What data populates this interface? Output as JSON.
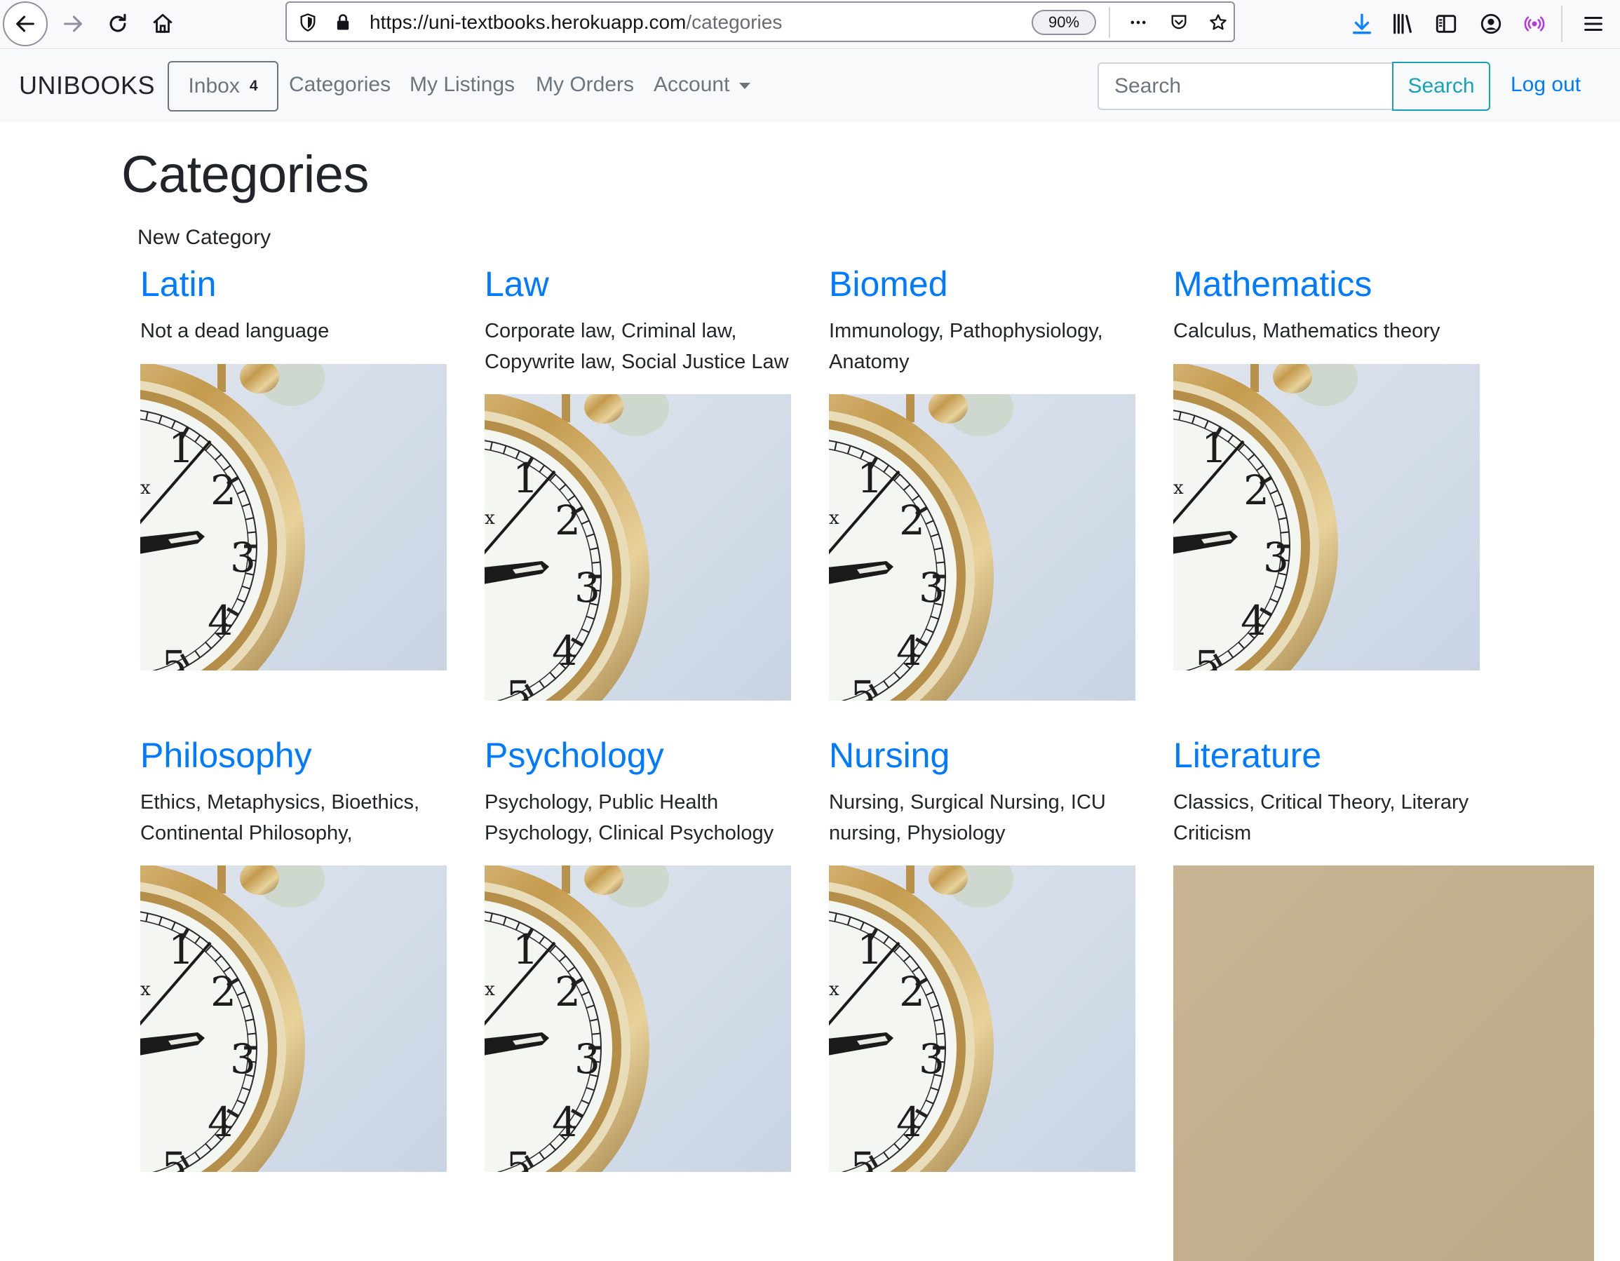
{
  "browser": {
    "url_host": "https://uni-textbooks.herokuapp.com",
    "url_path": "/categories",
    "zoom": "90%"
  },
  "navbar": {
    "brand": "UNIBOOKS",
    "inbox_label": "Inbox",
    "inbox_count": "4",
    "links": {
      "categories": "Categories",
      "listings": "My Listings",
      "orders": "My Orders",
      "account": "Account"
    },
    "search_placeholder": "Search",
    "search_button": "Search",
    "logout": "Log out"
  },
  "page": {
    "title": "Categories",
    "new_category": "New Category"
  },
  "categories": [
    {
      "name": "Latin",
      "description": "Not a dead language",
      "image": "alarm-clock"
    },
    {
      "name": "Law",
      "description": "Corporate law, Criminal law, Copywrite law, Social Justice Law",
      "image": "alarm-clock"
    },
    {
      "name": "Biomed",
      "description": "Immunology, Pathophysiology, Anatomy",
      "image": "alarm-clock"
    },
    {
      "name": "Mathematics",
      "description": "Calculus, Mathematics theory",
      "image": "alarm-clock"
    },
    {
      "name": "Philosophy",
      "description": "Ethics, Metaphysics, Bioethics, Continental Philosophy,",
      "image": "alarm-clock"
    },
    {
      "name": "Psychology",
      "description": "Psychology, Public Health Psychology, Clinical Psychology",
      "image": "alarm-clock"
    },
    {
      "name": "Nursing",
      "description": "Nursing, Surgical Nursing, ICU nursing, Physiology",
      "image": "alarm-clock"
    },
    {
      "name": "Literature",
      "description": "Classics, Critical Theory, Literary Criticism",
      "image": "kraft-paper"
    }
  ],
  "colors": {
    "link": "#007bff",
    "search_accent": "#17a2b8",
    "navbar_bg": "#f8f9fa",
    "download_icon": "#0a84ff",
    "extension_icon": "#b833e1"
  }
}
